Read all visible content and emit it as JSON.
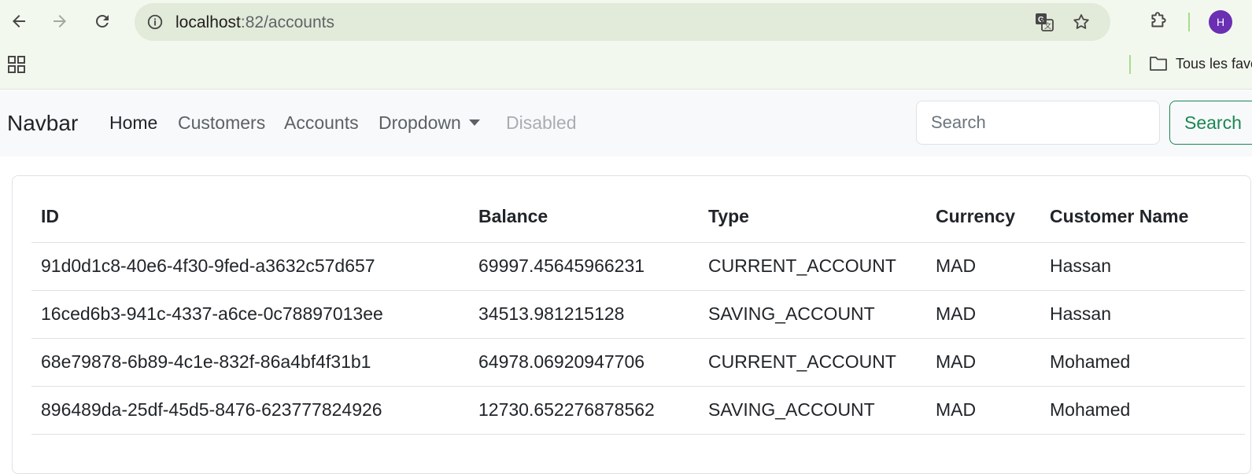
{
  "browser": {
    "url_host": "localhost",
    "url_path": ":82/accounts",
    "avatar_letter": "H",
    "bookmark_folder": "Tous les favoris",
    "icons": {
      "back": "arrow-left-icon",
      "forward": "arrow-right-icon",
      "reload": "reload-icon",
      "info": "info-icon",
      "translate": "translate-icon",
      "bookmark": "star-icon",
      "extensions": "puzzle-icon",
      "apps": "apps-grid-icon",
      "folder": "folder-icon"
    }
  },
  "navbar": {
    "brand": "Navbar",
    "links": {
      "home": "Home",
      "customers": "Customers",
      "accounts": "Accounts",
      "dropdown": "Dropdown",
      "disabled": "Disabled"
    },
    "search_placeholder": "Search",
    "search_button": "Search"
  },
  "table": {
    "headers": {
      "id": "ID",
      "balance": "Balance",
      "type": "Type",
      "currency": "Currency",
      "customer_name": "Customer Name"
    },
    "rows": [
      {
        "id": "91d0d1c8-40e6-4f30-9fed-a3632c57d657",
        "balance": "69997.45645966231",
        "type": "CURRENT_ACCOUNT",
        "currency": "MAD",
        "customer_name": "Hassan"
      },
      {
        "id": "16ced6b3-941c-4337-a6ce-0c78897013ee",
        "balance": "34513.981215128",
        "type": "SAVING_ACCOUNT",
        "currency": "MAD",
        "customer_name": "Hassan"
      },
      {
        "id": "68e79878-6b89-4c1e-832f-86a4bf4f31b1",
        "balance": "64978.06920947706",
        "type": "CURRENT_ACCOUNT",
        "currency": "MAD",
        "customer_name": "Mohamed"
      },
      {
        "id": "896489da-25df-45d5-8476-623777824926",
        "balance": "12730.652276878562",
        "type": "SAVING_ACCOUNT",
        "currency": "MAD",
        "customer_name": "Mohamed"
      }
    ]
  },
  "colors": {
    "chrome_bg": "#f3f8ee",
    "omnibox_bg": "#e2ead9",
    "navbar_bg": "#f8f9fa",
    "success": "#198754",
    "avatar": "#6a2fb2"
  }
}
